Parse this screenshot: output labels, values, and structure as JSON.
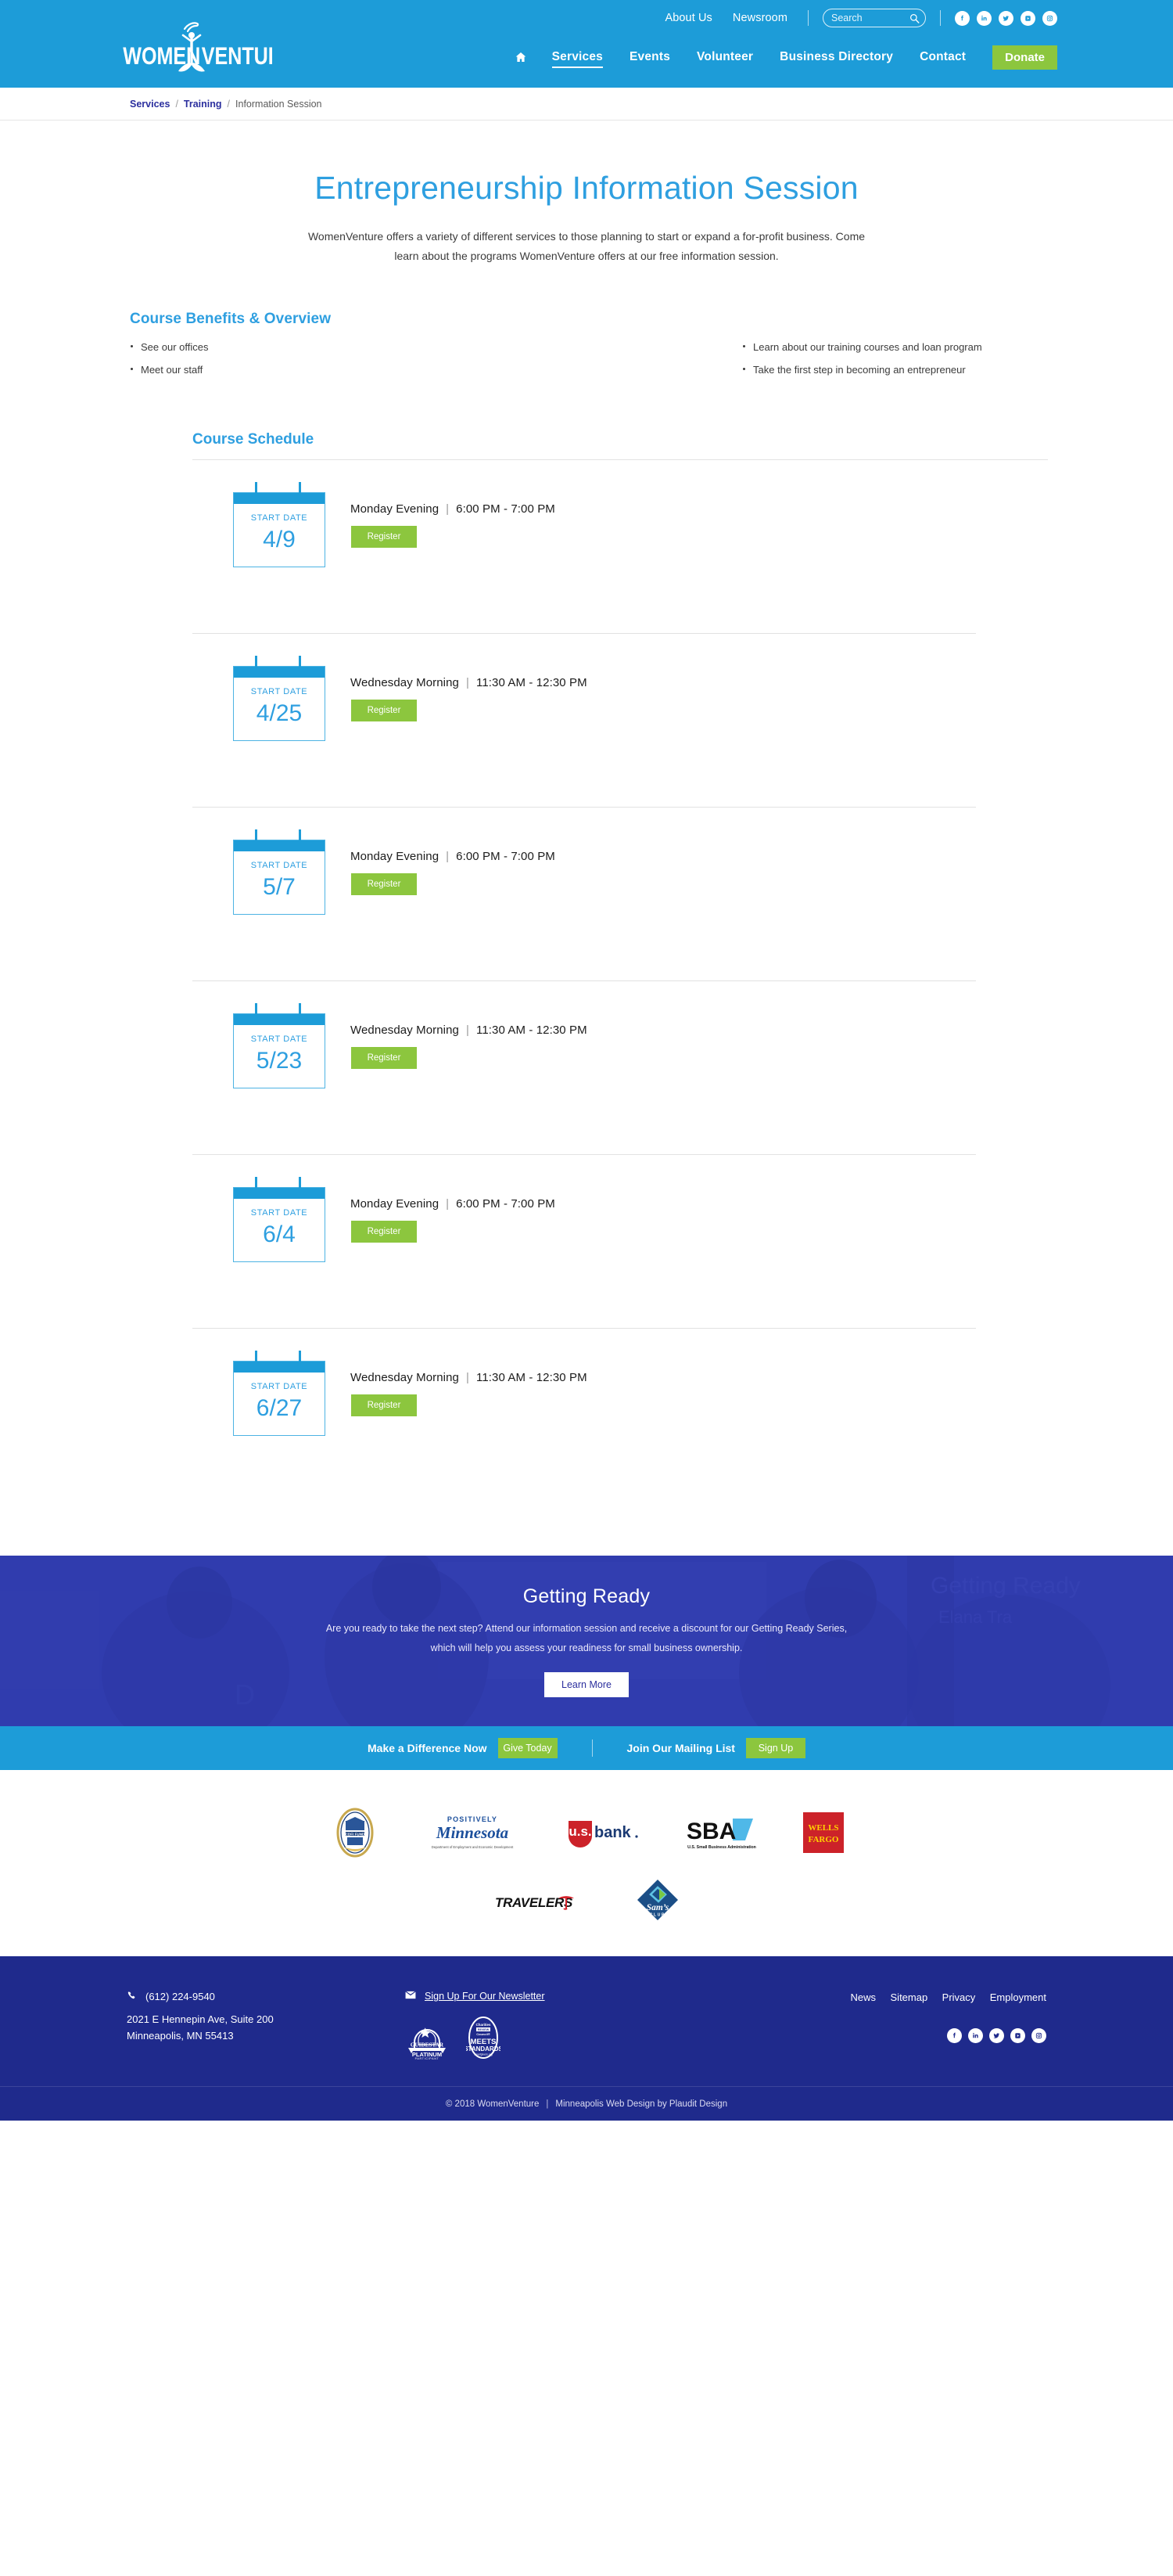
{
  "header": {
    "logo_text": "WOMEN VENTURE",
    "logo_tm": "™",
    "utility": {
      "links": [
        {
          "label": "About Us"
        },
        {
          "label": "Newsroom"
        }
      ],
      "search": {
        "placeholder": "Search",
        "value": "",
        "icon": "search-icon"
      },
      "social": [
        {
          "name": "facebook-icon",
          "glyph": "f"
        },
        {
          "name": "linkedin-icon",
          "glyph": "in"
        },
        {
          "name": "twitter-icon",
          "glyph": "t"
        },
        {
          "name": "youtube-icon",
          "glyph": "yt"
        },
        {
          "name": "instagram-icon",
          "glyph": "ig"
        }
      ]
    },
    "nav": {
      "home_icon": "home-icon",
      "items": [
        {
          "label": "Services",
          "active": true
        },
        {
          "label": "Events",
          "active": false
        },
        {
          "label": "Volunteer",
          "active": false
        },
        {
          "label": "Business Directory",
          "active": false
        },
        {
          "label": "Contact",
          "active": false
        }
      ],
      "donate_label": "Donate"
    }
  },
  "breadcrumb": {
    "items": [
      {
        "label": "Services",
        "link": true
      },
      {
        "label": "Training",
        "link": true
      },
      {
        "label": "Information Session",
        "link": false
      }
    ],
    "separator": "/"
  },
  "hero": {
    "title": "Entrepreneurship Information Session",
    "intro": "WomenVenture offers a variety of different services to those planning to start or expand a for-profit business. Come learn about the programs WomenVenture offers at our free information session."
  },
  "benefits": {
    "heading": "Course Benefits & Overview",
    "left": [
      "See our offices",
      "Meet our staff"
    ],
    "right": [
      "Learn about our training courses and loan program",
      "Take the first step in becoming an entrepreneur"
    ]
  },
  "schedule": {
    "heading": "Course Schedule",
    "start_date_label": "START DATE",
    "register_label": "Register",
    "pipe": "|",
    "rows": [
      {
        "date": "4/9",
        "day": "Monday Evening",
        "time": "6:00 PM - 7:00 PM"
      },
      {
        "date": "4/25",
        "day": "Wednesday Morning",
        "time": "11:30 AM - 12:30 PM"
      },
      {
        "date": "5/7",
        "day": "Monday Evening",
        "time": "6:00 PM - 7:00 PM"
      },
      {
        "date": "5/23",
        "day": "Wednesday Morning",
        "time": "11:30 AM - 12:30 PM"
      },
      {
        "date": "6/4",
        "day": "Monday Evening",
        "time": "6:00 PM - 7:00 PM"
      },
      {
        "date": "6/27",
        "day": "Wednesday Morning",
        "time": "11:30 AM - 12:30 PM"
      }
    ]
  },
  "getting_ready": {
    "title": "Getting Ready",
    "body": "Are you ready to take the next step? Attend our information session and receive a discount for our Getting Ready Series, which will help you assess your readiness for small business ownership.",
    "button": "Learn More"
  },
  "cta": {
    "donate_text": "Make a Difference Now",
    "donate_button": "Give Today",
    "mail_text": "Join Our Mailing List",
    "mail_button": "Sign Up"
  },
  "sponsors": {
    "row1": [
      {
        "name": "cdfi-fund-logo",
        "label": "CDFI FUND"
      },
      {
        "name": "positively-minnesota-logo",
        "label": "Positively Minnesota"
      },
      {
        "name": "us-bank-logo",
        "label": "usbank"
      },
      {
        "name": "sba-logo",
        "label": "SBA"
      },
      {
        "name": "wells-fargo-logo",
        "label": "WELLS FARGO"
      }
    ],
    "row2": [
      {
        "name": "travelers-logo",
        "label": "TRAVELERS"
      },
      {
        "name": "sams-club-logo",
        "label": "Sam's CLUB"
      }
    ],
    "sba_sub": "U.S. Small Business Administration",
    "mn_sub": "Department of Employment and Economic Development",
    "mn_top": "POSITIVELY",
    "mn_main": "Minnesota"
  },
  "footer": {
    "phone": "(612) 224-9540",
    "address_line1": "2021 E Hennepin Ave, Suite 200",
    "address_line2": "Minneapolis, MN 55413",
    "newsletter": "Sign Up For Our Newsletter",
    "badges": [
      {
        "name": "guidestar-platinum-badge",
        "l1": "GUIDESTAR",
        "l2": "PLATINUM",
        "l3": "PARTICIPANT"
      },
      {
        "name": "charities-review-badge",
        "l1": "Charities",
        "l2": "MEETS",
        "l3": "STANDARDS",
        "l4": "smartgivers.org"
      }
    ],
    "links": [
      {
        "label": "News"
      },
      {
        "label": "Sitemap"
      },
      {
        "label": "Privacy"
      },
      {
        "label": "Employment"
      }
    ],
    "social": [
      {
        "name": "facebook-icon"
      },
      {
        "name": "linkedin-icon"
      },
      {
        "name": "twitter-icon"
      },
      {
        "name": "youtube-icon"
      },
      {
        "name": "instagram-icon"
      }
    ],
    "copyright": "© 2018 WomenVenture",
    "copy_pipe": "|",
    "credit": "Minneapolis Web Design by Plaudit Design"
  },
  "colors": {
    "brand_blue": "#1d9cd8",
    "title_blue": "#2e9fe0",
    "green": "#8cc63e",
    "navy": "#1f2a8c",
    "banner_purple": "#2f3bab"
  }
}
